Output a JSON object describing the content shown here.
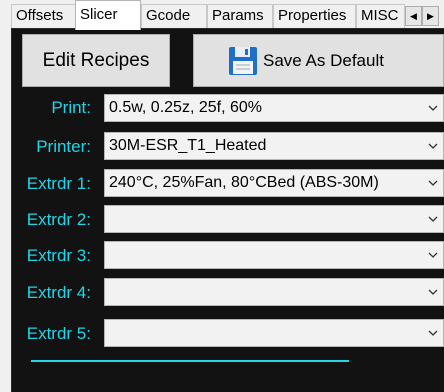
{
  "tabs": [
    {
      "label": "Offsets",
      "active": false
    },
    {
      "label": "Slicer",
      "active": true
    },
    {
      "label": "Gcode",
      "active": false
    },
    {
      "label": "Params",
      "active": false
    },
    {
      "label": "Properties",
      "active": false
    },
    {
      "label": "MISC",
      "active": false
    }
  ],
  "tab_scroll": {
    "left_icon": "scroll-left-icon",
    "right_icon": "scroll-right-icon"
  },
  "buttons": {
    "edit_recipes": "Edit Recipes",
    "save_default": "Save As Default",
    "save_icon": "floppy-disk-icon"
  },
  "rows": [
    {
      "label": "Print:",
      "value": "0.5w, 0.25z, 25f, 60%"
    },
    {
      "label": "Printer:",
      "value": "30M-ESR_T1_Heated"
    },
    {
      "label": "Extrdr 1:",
      "value": "240°C, 25%Fan, 80°CBed (ABS-30M)"
    },
    {
      "label": "Extrdr 2:",
      "value": ""
    },
    {
      "label": "Extrdr 3:",
      "value": ""
    },
    {
      "label": "Extrdr 4:",
      "value": ""
    },
    {
      "label": "Extrdr 5:",
      "value": ""
    }
  ],
  "colors": {
    "accent": "#20d6e8",
    "panel_bg": "#121212",
    "combo_bg": "#f2f2f2"
  }
}
